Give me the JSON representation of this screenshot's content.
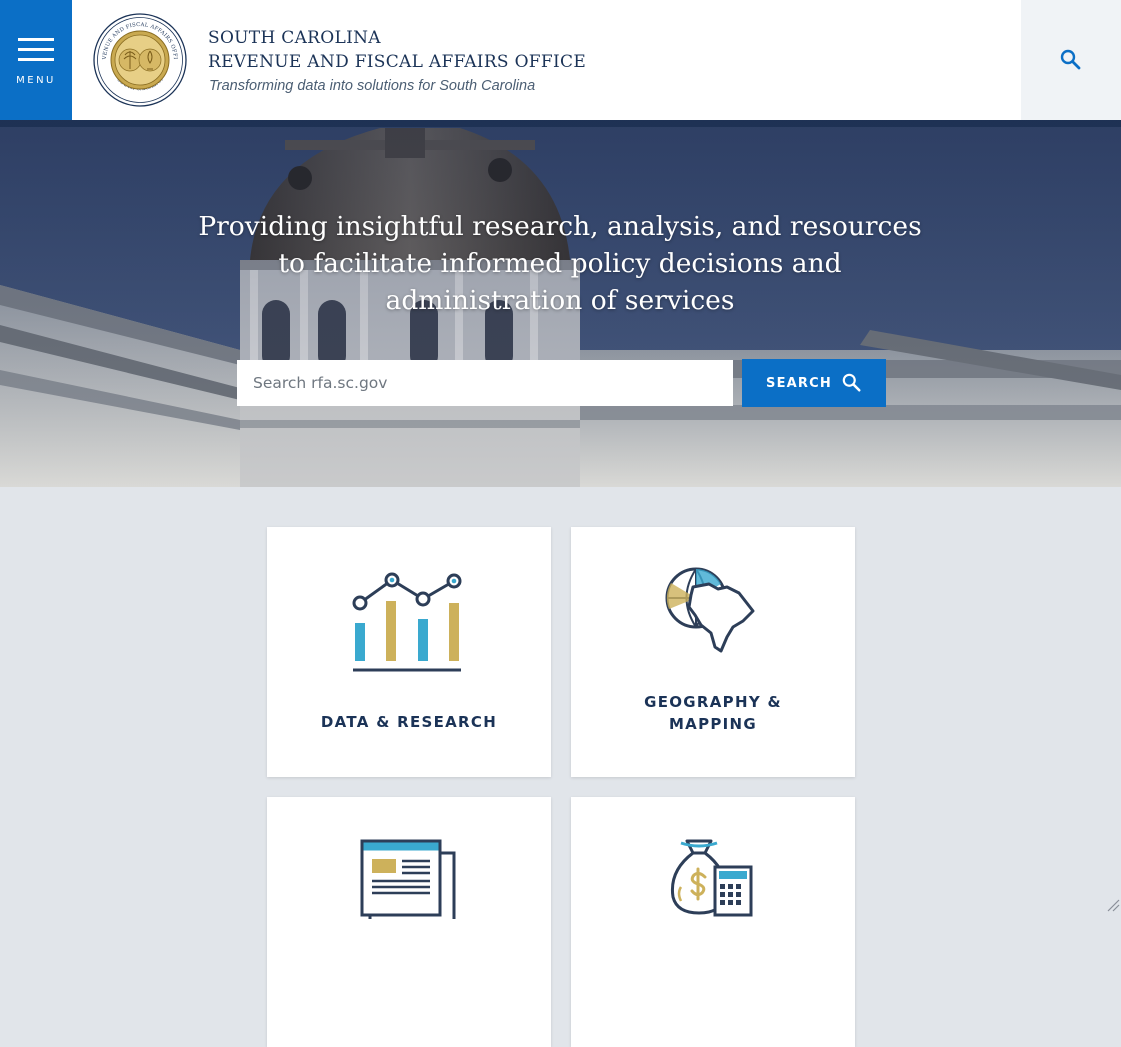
{
  "header": {
    "menu_label": "MENU",
    "org_line1": "SOUTH CAROLINA",
    "org_line2": "REVENUE AND FISCAL AFFAIRS OFFICE",
    "tagline": "Transforming data into solutions for South Carolina",
    "seal_text_top": "REVENUE AND FISCAL AFFAIRS OFFICE",
    "seal_text_bottom": "SOUTH CAROLINA",
    "search_icon": "search-icon"
  },
  "hero": {
    "line1": "Providing insightful research, analysis, and resources",
    "line2": "to facilitate informed policy decisions and",
    "line3": "administration of services",
    "search_placeholder": "Search rfa.sc.gov",
    "search_button": "SEARCH"
  },
  "cards": [
    {
      "label": "DATA & RESEARCH",
      "icon": "chart-icon"
    },
    {
      "label_line1": "GEOGRAPHY &",
      "label_line2": "MAPPING",
      "icon": "globe-map-icon"
    },
    {
      "label": "",
      "icon": "document-icon"
    },
    {
      "label": "",
      "icon": "money-calculator-icon"
    }
  ],
  "colors": {
    "primary_blue": "#0b6fc6",
    "navy": "#1b3357",
    "teal": "#3aa9cf",
    "gold": "#cdb15b",
    "background": "#e1e5ea"
  }
}
